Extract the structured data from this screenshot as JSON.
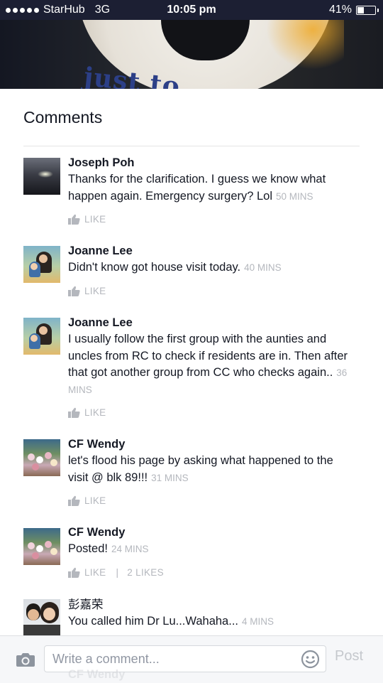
{
  "status_bar": {
    "carrier": "StarHub",
    "network": "3G",
    "time": "10:05 pm",
    "battery": "41%",
    "battery_fraction": 0.41
  },
  "header_photo": {
    "caption_fragment": "just to"
  },
  "comments_title": "Comments",
  "like_label": "LIKE",
  "comments": [
    {
      "name": "Joseph Poh",
      "text": "Thanks for the clarification. I guess we know what happen again. Emergency surgery? Lol",
      "time": "50 MINS",
      "likes": ""
    },
    {
      "name": "Joanne Lee",
      "text": "Didn't know got house visit today.",
      "time": "40 MINS",
      "likes": ""
    },
    {
      "name": "Joanne Lee",
      "text": "I usually follow the first group with the aunties and uncles from RC to check if residents are in. Then after that got another group from CC who checks again..",
      "time": "36 MINS",
      "likes": ""
    },
    {
      "name": "CF Wendy",
      "text": "let's flood his page by asking what happened to the visit @ blk 89!!!",
      "time": "31 MINS",
      "likes": ""
    },
    {
      "name": "CF Wendy",
      "text": "Posted!",
      "time": "24 MINS",
      "likes": "2 LIKES"
    },
    {
      "name": "彭嘉荣",
      "text": "You called him Dr Lu...Wahaha...",
      "time": "4 MINS",
      "likes": ""
    }
  ],
  "peek_comment_name": "CF Wendy",
  "composer": {
    "placeholder": "Write a comment...",
    "post_label": "Post"
  },
  "colors": {
    "status_bar_bg": "#1c1f33",
    "meta_gray": "#b4b7bd",
    "text": "#141823"
  },
  "icons": [
    "signal-dots-icon",
    "battery-icon",
    "like-thumb-icon",
    "camera-icon",
    "emoji-icon"
  ]
}
